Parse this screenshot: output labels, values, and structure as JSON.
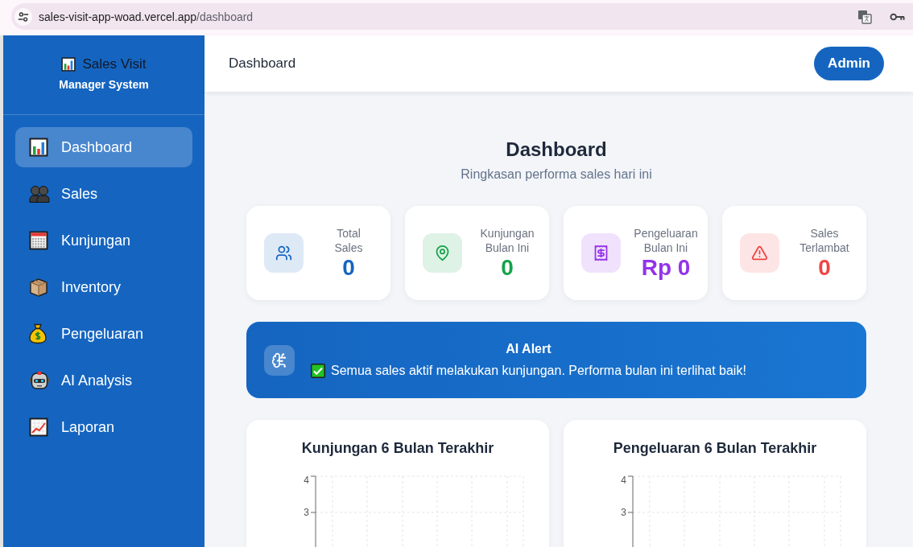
{
  "browser": {
    "url": "sales-visit-app-woad.vercel.app/dashboard"
  },
  "sidebar": {
    "title": "Sales Visit",
    "subtitle": "Manager System",
    "items": [
      {
        "label": "Dashboard",
        "selected": true
      },
      {
        "label": "Sales",
        "selected": false
      },
      {
        "label": "Kunjungan",
        "selected": false
      },
      {
        "label": "Inventory",
        "selected": false
      },
      {
        "label": "Pengeluaran",
        "selected": false
      },
      {
        "label": "AI Analysis",
        "selected": false
      },
      {
        "label": "Laporan",
        "selected": false
      }
    ]
  },
  "header": {
    "title": "Dashboard",
    "user_button": "Admin"
  },
  "page": {
    "title": "Dashboard",
    "subtitle": "Ringkasan performa sales hari ini"
  },
  "stats": [
    {
      "label": "Total\nSales",
      "value": "0",
      "color": "#1565c0"
    },
    {
      "label": "Kunjungan\nBulan Ini",
      "value": "0",
      "color": "#16a34a"
    },
    {
      "label": "Pengeluaran\nBulan Ini",
      "value": "Rp 0",
      "color": "#9333ea"
    },
    {
      "label": "Sales\nTerlambat",
      "value": "0",
      "color": "#ef4444"
    }
  ],
  "ai_alert": {
    "title": "AI Alert",
    "message": "Semua sales aktif melakukan kunjungan. Performa bulan ini terlihat baik!"
  },
  "charts": [
    {
      "title": "Kunjungan 6 Bulan Terakhir",
      "y_axis_labels": [
        "4",
        "3"
      ]
    },
    {
      "title": "Pengeluaran 6 Bulan Terakhir",
      "y_axis_labels": [
        "4",
        "3"
      ]
    }
  ]
}
